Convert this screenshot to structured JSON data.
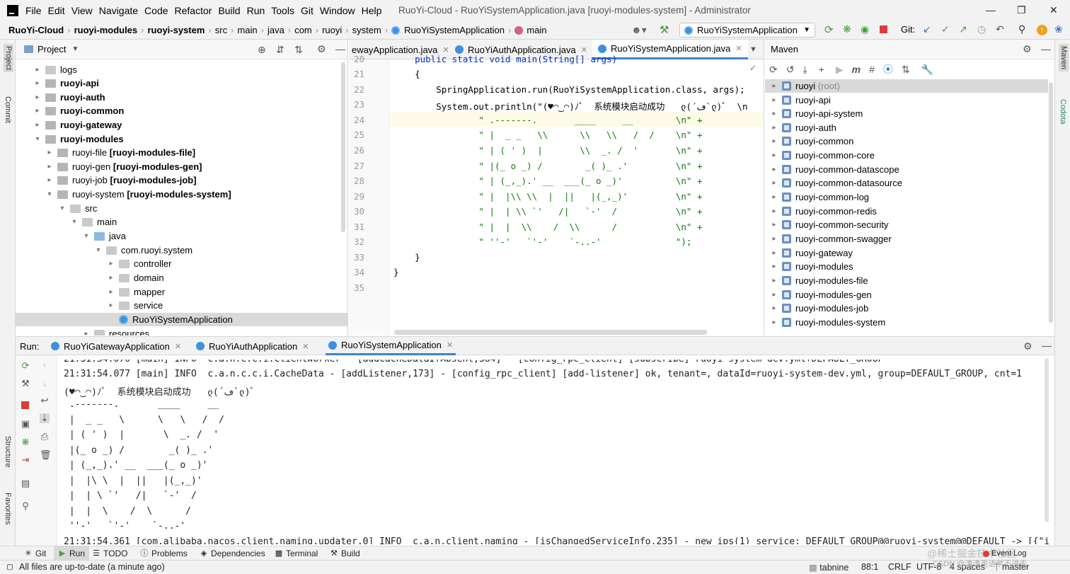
{
  "title_bar": {
    "menu": [
      "File",
      "Edit",
      "View",
      "Navigate",
      "Code",
      "Refactor",
      "Build",
      "Run",
      "Tools",
      "Git",
      "Window",
      "Help"
    ],
    "window_title": "RuoYi-Cloud - RuoYiSystemApplication.java [ruoyi-modules-system] - Administrator"
  },
  "nav": {
    "crumbs": [
      "RuoYi-Cloud",
      "ruoyi-modules",
      "ruoyi-system",
      "src",
      "main",
      "java",
      "com",
      "ruoyi",
      "system",
      "RuoYiSystemApplication",
      "main"
    ],
    "run_config": "RuoYiSystemApplication",
    "git_label": "Git:"
  },
  "stripes": {
    "left_top": "Project",
    "left_commit": "Commit",
    "left_structure": "Structure",
    "left_favorites": "Favorites",
    "right_maven": "Maven",
    "right_codota": "Codota"
  },
  "project": {
    "title": "Project",
    "items": [
      {
        "label": "logs",
        "bold": false,
        "module": ""
      },
      {
        "label": "ruoyi-api",
        "bold": true,
        "module": ""
      },
      {
        "label": "ruoyi-auth",
        "bold": true,
        "module": ""
      },
      {
        "label": "ruoyi-common",
        "bold": true,
        "module": ""
      },
      {
        "label": "ruoyi-gateway",
        "bold": true,
        "module": ""
      },
      {
        "label": "ruoyi-modules",
        "bold": true,
        "module": ""
      },
      {
        "label": "ruoyi-file",
        "bold": false,
        "module": "[ruoyi-modules-file]"
      },
      {
        "label": "ruoyi-gen",
        "bold": false,
        "module": "[ruoyi-modules-gen]"
      },
      {
        "label": "ruoyi-job",
        "bold": false,
        "module": "[ruoyi-modules-job]"
      },
      {
        "label": "ruoyi-system",
        "bold": false,
        "module": "[ruoyi-modules-system]"
      },
      {
        "label": "src",
        "bold": false,
        "module": ""
      },
      {
        "label": "main",
        "bold": false,
        "module": ""
      },
      {
        "label": "java",
        "bold": false,
        "module": ""
      },
      {
        "label": "com.ruoyi.system",
        "bold": false,
        "module": ""
      },
      {
        "label": "controller",
        "bold": false,
        "module": ""
      },
      {
        "label": "domain",
        "bold": false,
        "module": ""
      },
      {
        "label": "mapper",
        "bold": false,
        "module": ""
      },
      {
        "label": "service",
        "bold": false,
        "module": ""
      },
      {
        "label": "RuoYiSystemApplication",
        "bold": false,
        "module": ""
      },
      {
        "label": "resources",
        "bold": false,
        "module": ""
      }
    ]
  },
  "editor": {
    "tabs": [
      "ewayApplication.java",
      "RuoYiAuthApplication.java",
      "RuoYiSystemApplication.java"
    ],
    "lines": [
      {
        "n": "20",
        "text": "    public static void main(String[] args)"
      },
      {
        "n": "21",
        "text": "    {"
      },
      {
        "n": "22",
        "text": "        SpringApplication.run(RuoYiSystemApplication.class, args);"
      },
      {
        "n": "23",
        "text": "        System.out.println(\"(♥◠‿◠)ﾉﾞ  系统模块启动成功   ლ(´ڡ`ლ)ﾞ  \\n"
      },
      {
        "n": "24",
        "text": "                \" .-------.       ____     __        \\n\" +"
      },
      {
        "n": "25",
        "text": "                \" |  _ _   \\\\      \\\\   \\\\   /  /    \\n\" +"
      },
      {
        "n": "26",
        "text": "                \" | ( ' )  |       \\\\  _. /  '       \\n\" +"
      },
      {
        "n": "27",
        "text": "                \" |(_ o _) /        _( )_ .'         \\n\" +"
      },
      {
        "n": "28",
        "text": "                \" | (_,_).' __  ___(_ o _)'          \\n\" +"
      },
      {
        "n": "29",
        "text": "                \" |  |\\\\ \\\\  |  ||   |(_,_)'         \\n\" +"
      },
      {
        "n": "30",
        "text": "                \" |  | \\\\ `'   /|   `-'  /           \\n\" +"
      },
      {
        "n": "31",
        "text": "                \" |  |  \\\\    /  \\\\      /           \\n\" +"
      },
      {
        "n": "32",
        "text": "                \" ''-'   `'-'    `-..-'              \");"
      },
      {
        "n": "33",
        "text": "    }"
      },
      {
        "n": "34",
        "text": "}"
      },
      {
        "n": "35",
        "text": ""
      }
    ]
  },
  "maven": {
    "title": "Maven",
    "items": [
      "ruoyi",
      "ruoyi-api",
      "ruoyi-api-system",
      "ruoyi-auth",
      "ruoyi-common",
      "ruoyi-common-core",
      "ruoyi-common-datascope",
      "ruoyi-common-datasource",
      "ruoyi-common-log",
      "ruoyi-common-redis",
      "ruoyi-common-security",
      "ruoyi-common-swagger",
      "ruoyi-gateway",
      "ruoyi-modules",
      "ruoyi-modules-file",
      "ruoyi-modules-gen",
      "ruoyi-modules-job",
      "ruoyi-modules-system"
    ],
    "root_suffix": "(root)"
  },
  "run": {
    "label": "Run:",
    "tabs": [
      "RuoYiGatewayApplication",
      "RuoYiAuthApplication",
      "RuoYiSystemApplication"
    ],
    "console": [
      "21:31:54.076 [main] INFO  c.a.n.c.c.i.ClientWorker - [addCacheDataIfAbsent,384] - [config_rpc_client] [subscribe] ruoyi-system-dev.yml+DEFAULT_GROUP",
      "21:31:54.077 [main] INFO  c.a.n.c.c.i.CacheData - [addListener,173] - [config_rpc_client] [add-listener] ok, tenant=, dataId=ruoyi-system-dev.yml, group=DEFAULT_GROUP, cnt=1",
      "(♥◠‿◠)ﾉﾞ  系统模块启动成功   ლ(´ڡ`ლ)ﾞ",
      " .-------.       ____     __",
      " |  _ _   \\      \\   \\   /  /",
      " | ( ' )  |       \\  _. /  '",
      " |(_ o _) /        _( )_ .'",
      " | (_,_).' __  ___(_ o _)'",
      " |  |\\ \\  |  ||   |(_,_)'",
      " |  | \\ `'   /|   `-'  /",
      " |  |  \\    /  \\      /",
      " ''-'   `'-'    `-..-'",
      "21:31:54.361 [com.alibaba.nacos.client.naming.updater.0] INFO  c.a.n.client.naming - [isChangedServiceInfo,235] - new ips(1) service: DEFAULT_GROUP@@ruoyi-system@@DEFAULT -> [{\"i"
    ]
  },
  "bottom_tabs": [
    "Git",
    "Run",
    "TODO",
    "Problems",
    "Dependencies",
    "Terminal",
    "Build"
  ],
  "status": {
    "message": "All files are up-to-date (a minute ago)",
    "tabnine": "tabnine",
    "position": "88:1",
    "line_sep": "CRLF",
    "encoding": "UTF-8",
    "indent": "4 spaces",
    "branch": "master",
    "event_log": "Event Log",
    "watermark": "@稀土掘金技术社区",
    "watermark2": "CSDN @涛涛英语学不进去"
  }
}
